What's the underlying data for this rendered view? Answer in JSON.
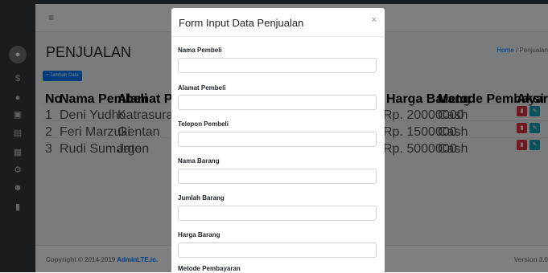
{
  "page": {
    "title": "PENJUALAN",
    "breadcrumb": {
      "home": "Home",
      "separator": "/",
      "current": "Penjualan"
    },
    "add_button": "+ Tambah Data"
  },
  "table": {
    "headers": [
      "No",
      "Nama Pembeli",
      "Alamat Pembeli",
      "Harga Barang",
      "Metode Pembayaran",
      "Aksi"
    ],
    "rows": [
      {
        "no": "1",
        "nama": "Deni Yudho",
        "alamat": "Katrasura",
        "harga": "Rp. 20000000",
        "metode": "Cash"
      },
      {
        "no": "2",
        "nama": "Feri Marzuki",
        "alamat": "Gentan",
        "harga": "Rp. 1500000",
        "metode": "Cash"
      },
      {
        "no": "3",
        "nama": "Rudi Sumargo",
        "alamat": "Jaten",
        "harga": "Rp. 5000000",
        "metode": "Cash"
      }
    ]
  },
  "footer": {
    "copyright_prefix": "Copyright © 2014-2019 ",
    "brand": "AdminLTE.io.",
    "version": "Version 3.0"
  },
  "modal": {
    "title": "Form Input Data Penjualan",
    "close": "×",
    "fields": [
      {
        "label": "Nama Pembeli",
        "value": ""
      },
      {
        "label": "Alamat Pembeli",
        "value": ""
      },
      {
        "label": "Telepon Pembeli",
        "value": ""
      },
      {
        "label": "Nama Barang",
        "value": ""
      },
      {
        "label": "Jumlah Barang",
        "value": ""
      },
      {
        "label": "Harga Barang",
        "value": ""
      },
      {
        "label": "Metode Pembayaran",
        "value": ""
      }
    ]
  },
  "icons": {
    "sidebar": [
      "avatar-icon",
      "dollar-icon",
      "circle-icon",
      "camera-icon",
      "image-icon",
      "calculator-icon",
      "gear-icon",
      "users-icon",
      "list-icon"
    ],
    "row_actions": [
      "trash-icon",
      "edit-icon"
    ]
  },
  "colors": {
    "primary": "#007bff",
    "danger": "#dc3545",
    "info": "#17a2b8",
    "sidebar": "#343a40"
  }
}
